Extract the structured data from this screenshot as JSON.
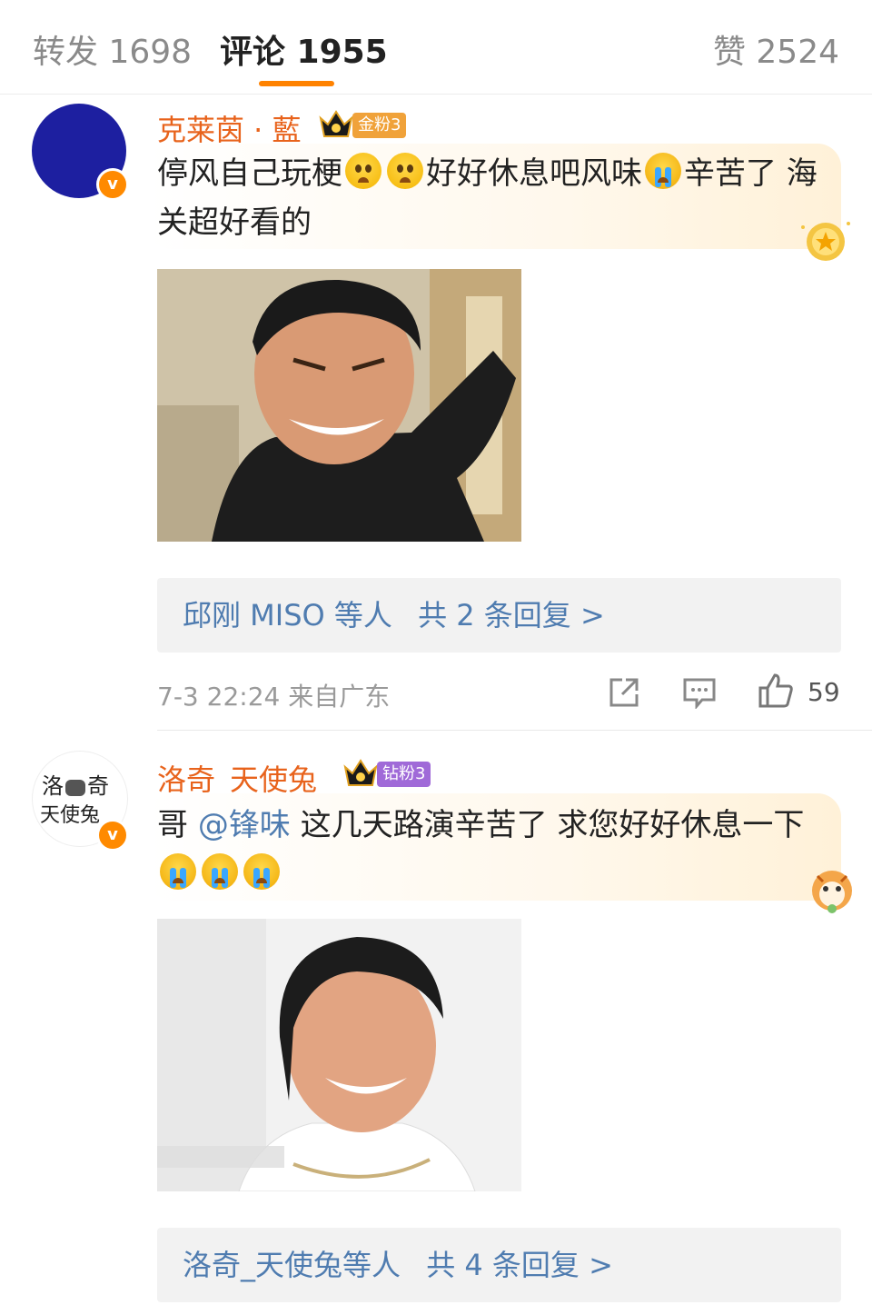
{
  "tabs": {
    "repost": "转发 1698",
    "comments": "评论 1955",
    "likes": "赞 2524"
  },
  "comments": [
    {
      "username": "克莱茵 · 藍",
      "fan_badge": "金粉3",
      "text_a": "停风自己玩梗",
      "text_b": "好好休息吧风味",
      "text_c": "辛苦了  海关超好看的",
      "reply_names": "邱刚 MISO 等人",
      "reply_count": "共 2 条回复 >",
      "time": "7-3 22:24  来自广东",
      "likes": "59"
    },
    {
      "username": "洛奇_天使兔",
      "fan_badge": "钻粉3",
      "text_a": "哥 ",
      "mention": "@锋味",
      "text_b": " 这几天路演辛苦了 求您好好休息一下",
      "avatar_text_1": "洛",
      "avatar_text_2": "奇",
      "avatar_text_3": "天使兔",
      "reply_names": "洛奇_天使兔等人",
      "reply_count": "共 4 条回复 >"
    }
  ],
  "colors": {
    "accent": "#ff8200",
    "username": "#e8631c",
    "link": "#4f7cb0",
    "gold_badge": "#f0a23a",
    "diamond_badge": "#a06ad8"
  }
}
